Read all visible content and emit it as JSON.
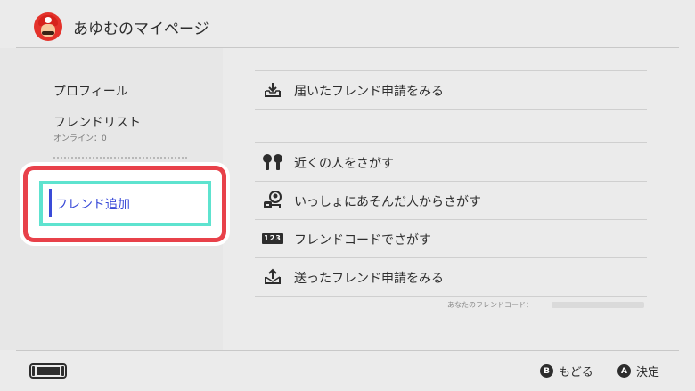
{
  "header": {
    "title": "あゆむのマイページ"
  },
  "sidebar": {
    "items": [
      {
        "label": "プロフィール"
      },
      {
        "label": "フレンドリスト",
        "sub": "オンライン：0"
      },
      {
        "label": "フレンド追加"
      }
    ]
  },
  "menu": {
    "items": [
      {
        "label": "届いたフレンド申請をみる",
        "icon": "inbox-download-icon"
      },
      {
        "label": "近くの人をさがす",
        "icon": "people-nearby-icon"
      },
      {
        "label": "いっしょにあそんだ人からさがす",
        "icon": "played-with-icon"
      },
      {
        "label": "フレンドコードでさがす",
        "icon": "friend-code-icon",
        "icon_text": "123"
      },
      {
        "label": "送ったフレンド申請をみる",
        "icon": "outbox-upload-icon"
      }
    ],
    "friend_code_caption": "あなたのフレンドコード："
  },
  "footer": {
    "back": {
      "button": "B",
      "label": "もどる"
    },
    "confirm": {
      "button": "A",
      "label": "決定"
    }
  },
  "colors": {
    "accent_blue": "#3a4bd8",
    "focus_red": "#e8414a",
    "focus_teal": "#5ee3cf"
  }
}
